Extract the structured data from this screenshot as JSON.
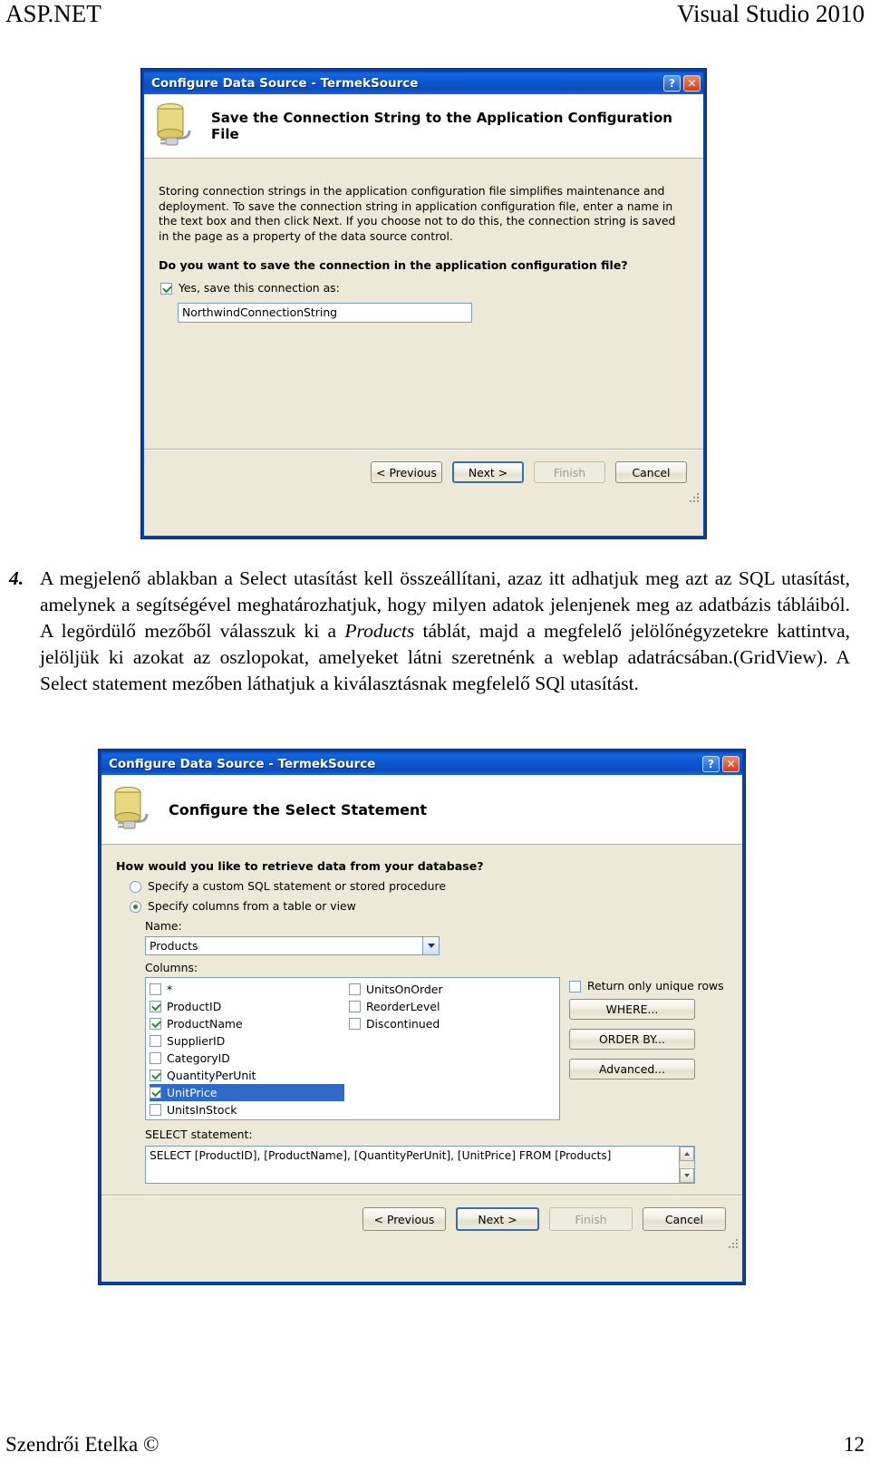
{
  "page": {
    "header_left": "ASP.NET",
    "header_right": "Visual Studio 2010",
    "footer_left": "Szendrői Etelka ©",
    "footer_right": "12"
  },
  "paragraph": {
    "number": "4.",
    "part1": "A megjelenő ablakban a Select utasítást kell összeállítani, azaz itt adhatjuk meg azt az SQL utasítást, amelynek a segítségével meghatározhatjuk, hogy milyen adatok jelenjenek meg az adatbázis tábláiból. A legördülő mezőből válasszuk ki a ",
    "emphasis": "Products",
    "part2": " táblát, majd a megfelelő jelölőnégyzetekre kattintva, jelöljük ki azokat az oszlopokat, amelyeket látni szeretnénk a weblap adatrácsában.(GridView). A Select statement mezőben láthatjuk a kiválasztásnak megfelelő SQl utasítást."
  },
  "dialog1": {
    "title": "Configure Data Source - TermekSource",
    "help_button": "?",
    "close_button": "✕",
    "banner_heading": "Save the Connection String to the Application Configuration File",
    "description": "Storing connection strings in the application configuration file simplifies maintenance and deployment. To save the connection string in application configuration file, enter a name in the text box and then click Next. If you choose not to do this, the connection string is saved in the page as a property of the data source control.",
    "question": "Do you want to save the connection in the application configuration file?",
    "checkbox_label": "Yes, save this connection as:",
    "checkbox_checked": true,
    "connection_name_value": "NorthwindConnectionString",
    "buttons": {
      "previous": "< Previous",
      "next": "Next >",
      "finish": "Finish",
      "cancel": "Cancel"
    }
  },
  "dialog2": {
    "title": "Configure Data Source - TermekSource",
    "help_button": "?",
    "close_button": "✕",
    "banner_heading": "Configure the Select Statement",
    "question": "How would you like to retrieve data from your database?",
    "radio_custom_sql": "Specify a custom SQL statement or stored procedure",
    "radio_columns": "Specify columns from a table or view",
    "radio_selected": "columns",
    "name_label": "Name:",
    "table_selected": "Products",
    "columns_label": "Columns:",
    "columns_left": [
      {
        "label": "*",
        "checked": false,
        "selected": false
      },
      {
        "label": "ProductID",
        "checked": true,
        "selected": false
      },
      {
        "label": "ProductName",
        "checked": true,
        "selected": false
      },
      {
        "label": "SupplierID",
        "checked": false,
        "selected": false
      },
      {
        "label": "CategoryID",
        "checked": false,
        "selected": false
      },
      {
        "label": "QuantityPerUnit",
        "checked": true,
        "selected": false
      },
      {
        "label": "UnitPrice",
        "checked": true,
        "selected": true
      },
      {
        "label": "UnitsInStock",
        "checked": false,
        "selected": false
      }
    ],
    "columns_right": [
      {
        "label": "UnitsOnOrder",
        "checked": false,
        "selected": false
      },
      {
        "label": "ReorderLevel",
        "checked": false,
        "selected": false
      },
      {
        "label": "Discontinued",
        "checked": false,
        "selected": false
      }
    ],
    "unique_rows_label": "Return only unique rows",
    "unique_rows_checked": false,
    "where_button": "WHERE...",
    "orderby_button": "ORDER BY...",
    "advanced_button": "Advanced...",
    "select_statement_label": "SELECT statement:",
    "select_statement": "SELECT [ProductID], [ProductName], [QuantityPerUnit], [UnitPrice] FROM [Products]",
    "buttons": {
      "previous": "< Previous",
      "next": "Next >",
      "finish": "Finish",
      "cancel": "Cancel"
    }
  },
  "colors": {
    "titlebar_blue": "#0b4cbe",
    "dialog_face": "#ece9d8",
    "selection_blue": "#3069c8",
    "check_green": "#2a8a2a"
  }
}
